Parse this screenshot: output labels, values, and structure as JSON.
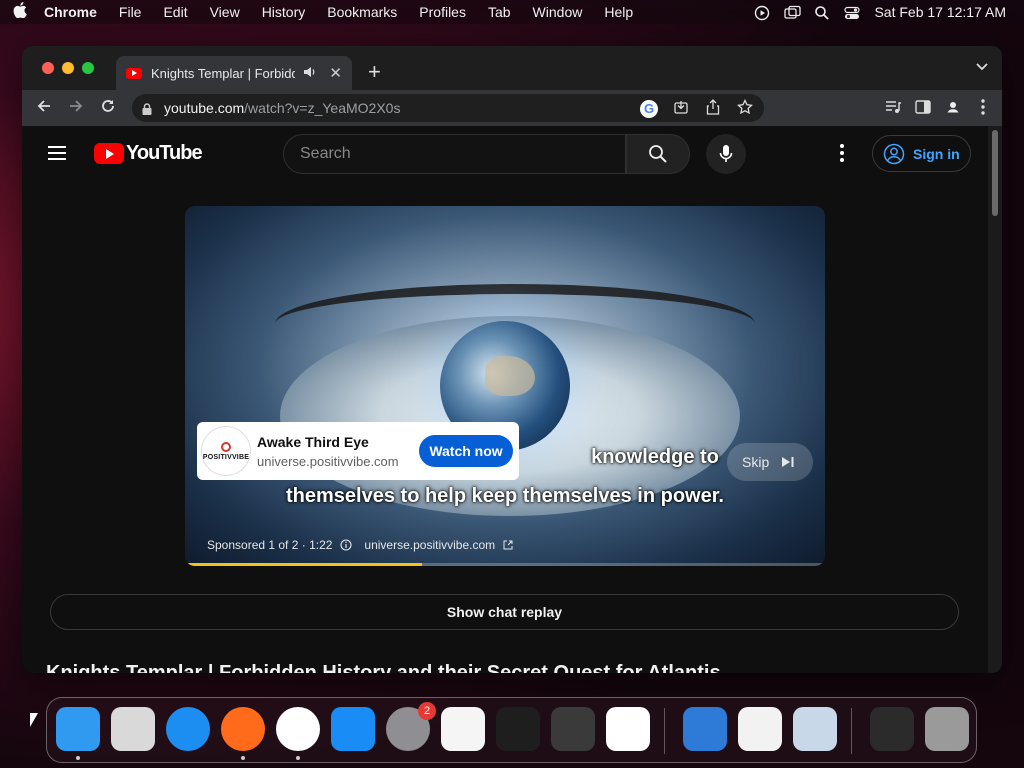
{
  "menubar": {
    "app_name": "Chrome",
    "items": [
      "File",
      "Edit",
      "View",
      "History",
      "Bookmarks",
      "Profiles",
      "Tab",
      "Window",
      "Help"
    ],
    "clock": "Sat Feb 17  12:17 AM"
  },
  "browser": {
    "tab_title": "Knights Templar | Forbidden History and their Secret Quest for Atlantis",
    "url_host": "youtube.com",
    "url_path": "/watch?v=z_YeaMO2X0s"
  },
  "youtube": {
    "logo_text": "YouTube",
    "search_placeholder": "Search",
    "sign_in_label": "Sign in",
    "caption_line1": "knowledge to",
    "caption_line2": "themselves to help keep themselves in power.",
    "ad": {
      "brand": "POSITIVVIBE",
      "title": "Awake Third Eye",
      "url": "universe.positivvibe.com",
      "cta": "Watch now"
    },
    "skip_label": "Skip",
    "sponsor_text": "Sponsored 1 of 2 · 1:22",
    "sponsor_url": "universe.positivvibe.com",
    "ad_progress": 0.37,
    "chat_replay_label": "Show chat replay",
    "video_title": "Knights Templar | Forbidden History and their Secret Quest for Atlantis"
  },
  "dock": {
    "apps": [
      {
        "name": "finder",
        "color": "#2f9af0"
      },
      {
        "name": "launchpad",
        "color": "#d9d9d9"
      },
      {
        "name": "safari",
        "color": "#1c8ef2"
      },
      {
        "name": "firefox",
        "color": "#ff6b1a"
      },
      {
        "name": "chrome",
        "color": "#ffffff"
      },
      {
        "name": "app-store",
        "color": "#1a8cf5"
      },
      {
        "name": "system-settings",
        "color": "#8e8e93"
      },
      {
        "name": "textedit",
        "color": "#f5f5f5"
      },
      {
        "name": "terminal",
        "color": "#1e1e1e"
      },
      {
        "name": "garageband",
        "color": "#3a3a3a"
      },
      {
        "name": "vscode",
        "color": "#ffffff"
      },
      {
        "name": "weather",
        "color": "#2d7bd6"
      },
      {
        "name": "keynote",
        "color": "#f2f2f2"
      },
      {
        "name": "preview",
        "color": "#c8d8e8"
      },
      {
        "name": "downloads-stack",
        "color": "#2b2b2b"
      },
      {
        "name": "trash",
        "color": "#9a9a9a"
      }
    ],
    "settings_badge": "2"
  }
}
